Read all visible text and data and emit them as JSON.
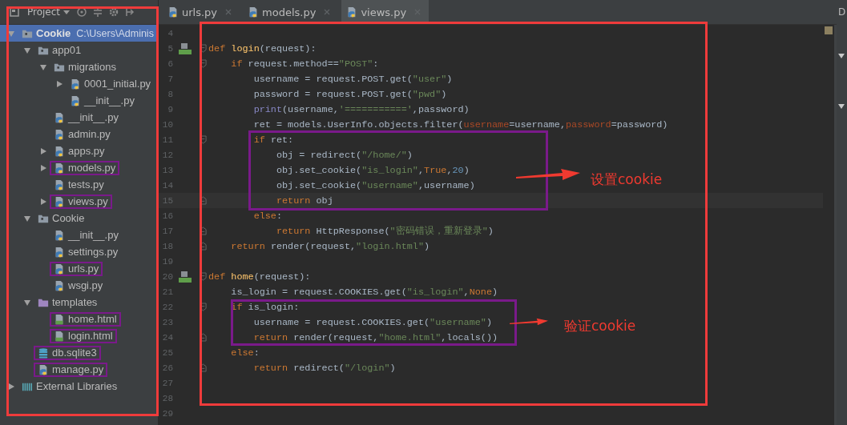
{
  "project_panel": {
    "title": "Project"
  },
  "tree": [
    {
      "label": "Cookie",
      "path": "C:\\Users\\Adminis",
      "kind": "folder",
      "expanded": true,
      "selected": true,
      "marked": false,
      "children": [
        {
          "label": "app01",
          "kind": "folder",
          "expanded": true,
          "selected": false,
          "marked": false,
          "children": [
            {
              "label": "migrations",
              "kind": "folder",
              "expanded": true,
              "selected": false,
              "marked": false,
              "children": [
                {
                  "label": "0001_initial.py",
                  "kind": "python",
                  "expanded": false,
                  "selected": false,
                  "marked": false
                },
                {
                  "label": "__init__.py",
                  "kind": "python",
                  "selected": false,
                  "marked": false
                }
              ]
            },
            {
              "label": "__init__.py",
              "kind": "python",
              "selected": false,
              "marked": false
            },
            {
              "label": "admin.py",
              "kind": "python",
              "selected": false,
              "marked": false
            },
            {
              "label": "apps.py",
              "kind": "python",
              "expanded": false,
              "selected": false,
              "marked": false
            },
            {
              "label": "models.py",
              "kind": "python",
              "expanded": false,
              "selected": false,
              "marked": true
            },
            {
              "label": "tests.py",
              "kind": "python",
              "selected": false,
              "marked": false
            },
            {
              "label": "views.py",
              "kind": "python",
              "expanded": false,
              "selected": false,
              "marked": true
            }
          ]
        },
        {
          "label": "Cookie",
          "kind": "folder",
          "expanded": true,
          "selected": false,
          "marked": false,
          "children": [
            {
              "label": "__init__.py",
              "kind": "python",
              "selected": false,
              "marked": false
            },
            {
              "label": "settings.py",
              "kind": "python",
              "selected": false,
              "marked": false
            },
            {
              "label": "urls.py",
              "kind": "python",
              "selected": false,
              "marked": true
            },
            {
              "label": "wsgi.py",
              "kind": "python",
              "selected": false,
              "marked": false
            }
          ]
        },
        {
          "label": "templates",
          "kind": "template-folder",
          "expanded": true,
          "selected": false,
          "marked": false,
          "children": [
            {
              "label": "home.html",
              "kind": "html",
              "selected": false,
              "marked": true
            },
            {
              "label": "login.html",
              "kind": "html",
              "selected": false,
              "marked": true
            }
          ]
        },
        {
          "label": "db.sqlite3",
          "kind": "database",
          "selected": false,
          "marked": true
        },
        {
          "label": "manage.py",
          "kind": "python",
          "selected": false,
          "marked": true
        }
      ]
    },
    {
      "label": "External Libraries",
      "kind": "library",
      "expanded": false,
      "selected": false,
      "marked": false
    }
  ],
  "tabs": [
    {
      "label": "urls.py",
      "selected": false
    },
    {
      "label": "models.py",
      "selected": false
    },
    {
      "label": "views.py",
      "selected": true
    }
  ],
  "code_lines": [
    {
      "number": "4"
    },
    {
      "number": "5",
      "override": true,
      "fold_start": true,
      "tokens": [
        {
          "text": "def ",
          "kind": "kw"
        },
        {
          "text": "login",
          "kind": "fn"
        },
        {
          "text": "(request):",
          "kind": "plain"
        }
      ]
    },
    {
      "number": "6",
      "fold_start": true,
      "tokens": [
        {
          "text": "    if ",
          "kind": "kw"
        },
        {
          "text": "request.method==",
          "kind": "plain"
        },
        {
          "text": "\"POST\"",
          "kind": "str"
        },
        {
          "text": ":",
          "kind": "plain"
        }
      ]
    },
    {
      "number": "7",
      "tokens": [
        {
          "text": "        username = request.POST.get(",
          "kind": "plain"
        },
        {
          "text": "\"user\"",
          "kind": "str"
        },
        {
          "text": ")",
          "kind": "plain"
        }
      ]
    },
    {
      "number": "8",
      "tokens": [
        {
          "text": "        password = request.POST.get(",
          "kind": "plain"
        },
        {
          "text": "\"pwd\"",
          "kind": "str"
        },
        {
          "text": ")",
          "kind": "plain"
        }
      ]
    },
    {
      "number": "9",
      "tokens": [
        {
          "text": "        print",
          "kind": "builtin"
        },
        {
          "text": "(username,",
          "kind": "plain"
        },
        {
          "text": "'==========='",
          "kind": "str"
        },
        {
          "text": ",password)",
          "kind": "plain"
        }
      ]
    },
    {
      "number": "10",
      "tokens": [
        {
          "text": "        ret = models.UserInfo.objects.filter(",
          "kind": "plain"
        },
        {
          "text": "username",
          "kind": "kwarg"
        },
        {
          "text": "=username,",
          "kind": "plain"
        },
        {
          "text": "password",
          "kind": "kwarg"
        },
        {
          "text": "=password)",
          "kind": "plain"
        }
      ]
    },
    {
      "number": "11",
      "fold_start": true,
      "tokens": [
        {
          "text": "        if ",
          "kind": "kw"
        },
        {
          "text": "ret:",
          "kind": "plain"
        }
      ]
    },
    {
      "number": "12",
      "tokens": [
        {
          "text": "            obj = redirect(",
          "kind": "plain"
        },
        {
          "text": "\"/home/\"",
          "kind": "str"
        },
        {
          "text": ")",
          "kind": "plain"
        }
      ]
    },
    {
      "number": "13",
      "tokens": [
        {
          "text": "            obj.set_cookie(",
          "kind": "plain"
        },
        {
          "text": "\"is_login\"",
          "kind": "str"
        },
        {
          "text": ",",
          "kind": "plain"
        },
        {
          "text": "True",
          "kind": "kw"
        },
        {
          "text": ",",
          "kind": "plain"
        },
        {
          "text": "20",
          "kind": "num"
        },
        {
          "text": ")",
          "kind": "plain"
        }
      ]
    },
    {
      "number": "14",
      "tokens": [
        {
          "text": "            obj.set_cookie(",
          "kind": "plain"
        },
        {
          "text": "\"username\"",
          "kind": "str"
        },
        {
          "text": ",username)",
          "kind": "plain"
        }
      ]
    },
    {
      "number": "15",
      "fold_end": true,
      "current": true,
      "tokens": [
        {
          "text": "            return ",
          "kind": "kw"
        },
        {
          "text": "obj",
          "kind": "plain"
        }
      ]
    },
    {
      "number": "16",
      "tokens": [
        {
          "text": "        else",
          "kind": "kw"
        },
        {
          "text": ":",
          "kind": "plain"
        }
      ]
    },
    {
      "number": "17",
      "fold_end": true,
      "tokens": [
        {
          "text": "            return ",
          "kind": "kw"
        },
        {
          "text": "HttpResponse(",
          "kind": "plain"
        },
        {
          "text": "\"密码错误，重新登录\"",
          "kind": "str"
        },
        {
          "text": ")",
          "kind": "plain"
        }
      ]
    },
    {
      "number": "18",
      "fold_end": true,
      "tokens": [
        {
          "text": "    return ",
          "kind": "kw"
        },
        {
          "text": "render(request,",
          "kind": "plain"
        },
        {
          "text": "\"login.html\"",
          "kind": "str"
        },
        {
          "text": ")",
          "kind": "plain"
        }
      ]
    },
    {
      "number": "19"
    },
    {
      "number": "20",
      "override": true,
      "fold_start": true,
      "tokens": [
        {
          "text": "def ",
          "kind": "kw"
        },
        {
          "text": "home",
          "kind": "fn"
        },
        {
          "text": "(request):",
          "kind": "plain"
        }
      ]
    },
    {
      "number": "21",
      "tokens": [
        {
          "text": "    is_login = request.COOKIES.get(",
          "kind": "plain"
        },
        {
          "text": "\"is_login\"",
          "kind": "str"
        },
        {
          "text": ",",
          "kind": "plain"
        },
        {
          "text": "None",
          "kind": "kw"
        },
        {
          "text": ")",
          "kind": "plain"
        }
      ]
    },
    {
      "number": "22",
      "fold_start": true,
      "tokens": [
        {
          "text": "    if ",
          "kind": "kw"
        },
        {
          "text": "is_login:",
          "kind": "plain"
        }
      ]
    },
    {
      "number": "23",
      "tokens": [
        {
          "text": "        username = request.COOKIES.get(",
          "kind": "plain"
        },
        {
          "text": "\"username\"",
          "kind": "str"
        },
        {
          "text": ")",
          "kind": "plain"
        }
      ]
    },
    {
      "number": "24",
      "fold_end": true,
      "tokens": [
        {
          "text": "        return ",
          "kind": "kw"
        },
        {
          "text": "render(request,",
          "kind": "plain"
        },
        {
          "text": "\"home.html\"",
          "kind": "str"
        },
        {
          "text": ",locals())",
          "kind": "plain"
        }
      ]
    },
    {
      "number": "25",
      "tokens": [
        {
          "text": "    else",
          "kind": "kw"
        },
        {
          "text": ":",
          "kind": "plain"
        }
      ]
    },
    {
      "number": "26",
      "fold_end": true,
      "tokens": [
        {
          "text": "        return ",
          "kind": "kw"
        },
        {
          "text": "redirect(",
          "kind": "plain"
        },
        {
          "text": "\"/login\"",
          "kind": "str"
        },
        {
          "text": ")",
          "kind": "plain"
        }
      ]
    },
    {
      "number": "27"
    },
    {
      "number": "28"
    },
    {
      "number": "29"
    }
  ],
  "callouts": [
    {
      "label": "设置cookie"
    },
    {
      "label": "验证cookie"
    }
  ],
  "side_panel": {
    "title": "D"
  }
}
